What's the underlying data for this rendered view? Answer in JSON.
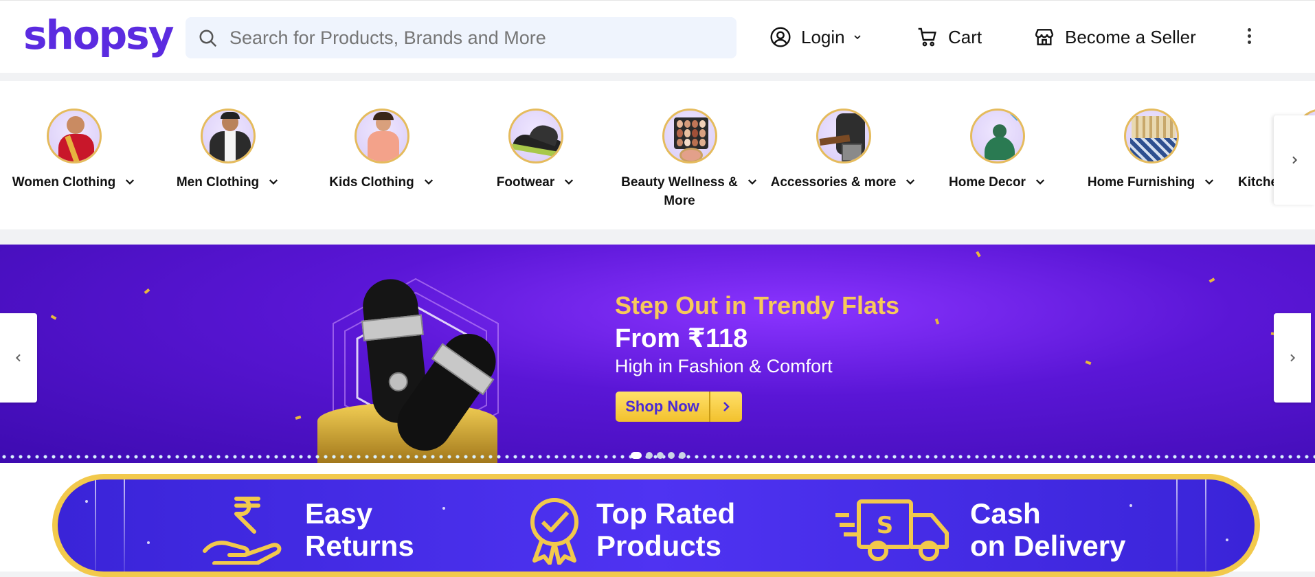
{
  "header": {
    "logo": "shopsy",
    "search_placeholder": "Search for Products, Brands and More",
    "login_label": "Login",
    "cart_label": "Cart",
    "seller_label": "Become a Seller"
  },
  "categories": [
    {
      "label": "Women Clothing",
      "icon": "saree-woman"
    },
    {
      "label": "Men Clothing",
      "icon": "man-shirt"
    },
    {
      "label": "Kids Clothing",
      "icon": "girl-dress"
    },
    {
      "label": "Footwear",
      "icon": "shoe"
    },
    {
      "label": "Beauty Wellness & More",
      "icon": "makeup-palette"
    },
    {
      "label": "Accessories & more",
      "icon": "bag-belt"
    },
    {
      "label": "Home Decor",
      "icon": "buddha-statue"
    },
    {
      "label": "Home Furnishing",
      "icon": "curtain-bedsheet"
    },
    {
      "label": "Kitche",
      "icon": "kitchen"
    }
  ],
  "banner": {
    "title": "Step Out in Trendy Flats",
    "price": "From ₹118",
    "subtitle": "High in Fashion & Comfort",
    "cta": "Shop Now",
    "slide_count": 5,
    "active_slide": 1
  },
  "features": [
    {
      "line1": "Easy",
      "line2": "Returns",
      "icon": "rupee-hand-icon"
    },
    {
      "line1": "Top Rated",
      "line2": "Products",
      "icon": "badge-check-icon"
    },
    {
      "line1": "Cash",
      "line2": "on Delivery",
      "icon": "delivery-truck-icon"
    }
  ],
  "colors": {
    "brand": "#5b2be0",
    "banner_gold": "#f7c95a",
    "strip_blue": "#4f33f2"
  }
}
